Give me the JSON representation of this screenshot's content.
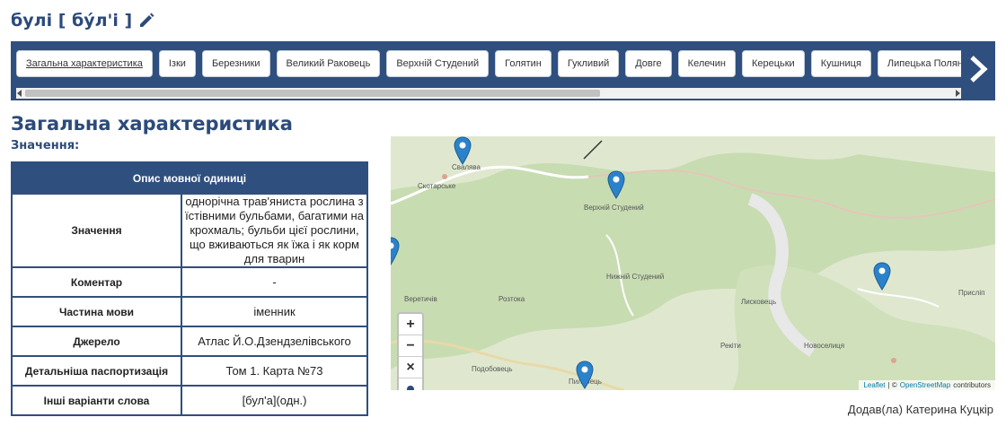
{
  "word": {
    "title": "булі [ бýл'і ]"
  },
  "tabs": [
    "Загальна характеристика",
    "Ізки",
    "Березники",
    "Великий Раковець",
    "Верхній Студений",
    "Голятин",
    "Гукливий",
    "Довге",
    "Келечин",
    "Керецьки",
    "Кушниця",
    "Липецька Поляна"
  ],
  "section": {
    "title": "Загальна характеристика",
    "value_label": "Значення:"
  },
  "table": {
    "header": "Опис мовної одиниці",
    "rows": [
      {
        "key": "Значення",
        "value": "однорічна трав'янистa рослина з їстівними бульбами, багатими на крохмаль; бульби цієї рослини, що вживаються як їжа і як корм для тварин"
      },
      {
        "key": "Коментар",
        "value": "-"
      },
      {
        "key": "Частина мови",
        "value": "іменник"
      },
      {
        "key": "Джерело",
        "value": "Атлас Й.О.Дзендзелівського"
      },
      {
        "key": "Детальніша паспортизація",
        "value": "Том 1. Карта №73"
      },
      {
        "key": "Інші варіанти слова",
        "value": "[бул'а](одн.)"
      }
    ]
  },
  "map": {
    "labels": [
      "Свалява",
      "Скотарське",
      "Верхній Студений",
      "Нижній Студений",
      "Лисковець",
      "Розтока",
      "Веретичів",
      "Подобовець",
      "Пилипець",
      "Рекіти",
      "Новоселиця",
      "Присліп"
    ],
    "zoom_in": "+",
    "zoom_out": "−",
    "close": "×",
    "attribution": {
      "leaflet": "Leaflet",
      "sep": "| ©",
      "osm": "OpenStreetMap",
      "contrib": "contributors"
    },
    "marker_color": "#2b82cb"
  },
  "author": "Додав(ла) Катерина Куцкір",
  "colors": {
    "brand": "#2f4f7f",
    "title": "#2c4a7a"
  }
}
